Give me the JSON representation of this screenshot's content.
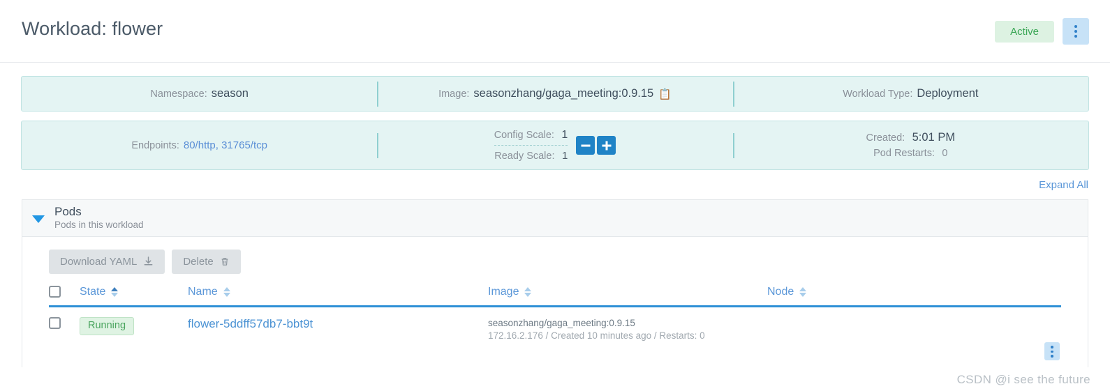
{
  "header": {
    "title": "Workload: flower",
    "state_badge": "Active",
    "kebab_icon": "vertical-dots-icon"
  },
  "info_panel_1": [
    {
      "label": "Namespace:",
      "value": "season"
    },
    {
      "label": "Image:",
      "value": "seasonzhang/gaga_meeting:0.9.15",
      "icon": "copy-icon",
      "icon_glyph": "📋"
    },
    {
      "label": "Workload Type:",
      "value": "Deployment"
    }
  ],
  "info_panel_2": {
    "endpoints": {
      "label": "Endpoints:",
      "value": "80/http, 31765/tcp"
    },
    "scale": {
      "config_label": "Config Scale:",
      "config_value": "1",
      "ready_label": "Ready Scale:",
      "ready_value": "1",
      "decrement_label": "−",
      "increment_label": "+"
    },
    "created": {
      "label": "Created:",
      "value": "5:01 PM",
      "restarts_label": "Pod Restarts:",
      "restarts_value": "0"
    }
  },
  "expand_all": "Expand All",
  "section": {
    "title": "Pods",
    "subtitle": "Pods in this workload",
    "caret_icon": "caret-down-icon",
    "buttons": [
      {
        "label": "Download YAML",
        "icon": "download-icon",
        "glyph": "⬇"
      },
      {
        "label": "Delete",
        "icon": "trash-icon",
        "glyph": "🗑"
      }
    ],
    "columns": [
      {
        "label": "State",
        "sorted": true
      },
      {
        "label": "Name",
        "sorted": false
      },
      {
        "label": "Image",
        "sorted": false
      },
      {
        "label": "Node",
        "sorted": false
      }
    ],
    "rows": [
      {
        "state": "Running",
        "name": "flower-5ddff57db7-bbt9t",
        "image_main": "seasonzhang/gaga_meeting:0.9.15",
        "image_sub": "172.16.2.176 / Created 10 minutes ago / Restarts: 0",
        "node": "",
        "kebab_icon": "vertical-dots-icon"
      }
    ]
  },
  "watermark": "CSDN @i see the future",
  "colors": {
    "accent_blue": "#2e90d6",
    "link_blue": "#5b97d8",
    "panel_bg": "#e4f4f3",
    "panel_border": "#bfe3e2",
    "success_green": "#4aa55f",
    "success_bg": "#dff3e3"
  }
}
